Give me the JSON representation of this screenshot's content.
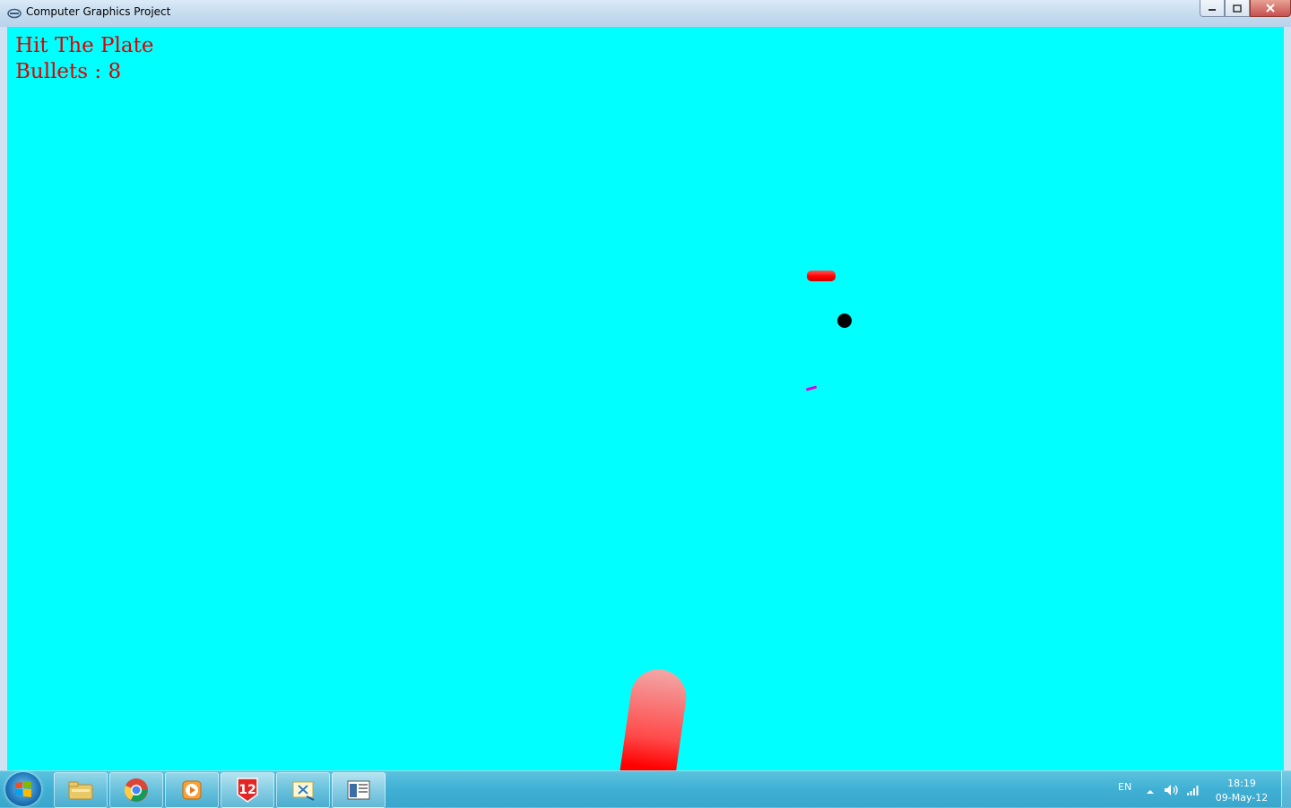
{
  "window": {
    "title": "Computer Graphics Project"
  },
  "game": {
    "title_text": "Hit The Plate",
    "bullets_label": "Bullets : 8",
    "background_color": "#00ffff",
    "text_color": "#e00000",
    "plate_color": "#ff0000",
    "bullet_color": "#000000",
    "shard_color": "#e000e0"
  },
  "taskbar": {
    "apps": [
      {
        "name": "windows-explorer-icon"
      },
      {
        "name": "chrome-icon"
      },
      {
        "name": "media-player-icon"
      },
      {
        "name": "app-12-icon",
        "label": "12"
      },
      {
        "name": "snipping-tool-icon"
      },
      {
        "name": "graphics-project-icon"
      }
    ],
    "tray": {
      "language": "EN",
      "time": "18:19",
      "date": "09-May-12"
    }
  }
}
